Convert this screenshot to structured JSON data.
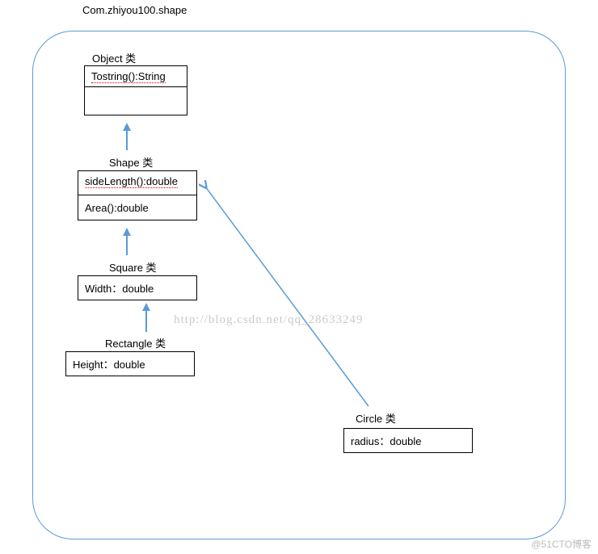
{
  "package_name": "Com.zhiyou100.shape",
  "classes": {
    "object": {
      "label": "Object 类",
      "methods": [
        "Tostring():String"
      ]
    },
    "shape": {
      "label": "Shape 类",
      "methods": [
        "sideLength():double",
        "Area():double"
      ]
    },
    "square": {
      "label": "Square 类",
      "fields": [
        "Width：double"
      ]
    },
    "rectangle": {
      "label": "Rectangle 类",
      "fields": [
        "Height：double"
      ]
    },
    "circle": {
      "label": "Circle 类",
      "fields": [
        "radius：double"
      ]
    }
  },
  "inheritance": [
    {
      "from": "shape",
      "to": "object"
    },
    {
      "from": "square",
      "to": "shape"
    },
    {
      "from": "rectangle",
      "to": "square"
    },
    {
      "from": "circle",
      "to": "shape"
    }
  ],
  "watermark": "http://blog.csdn.net/qq_28633249",
  "footer": "@51CTO博客"
}
